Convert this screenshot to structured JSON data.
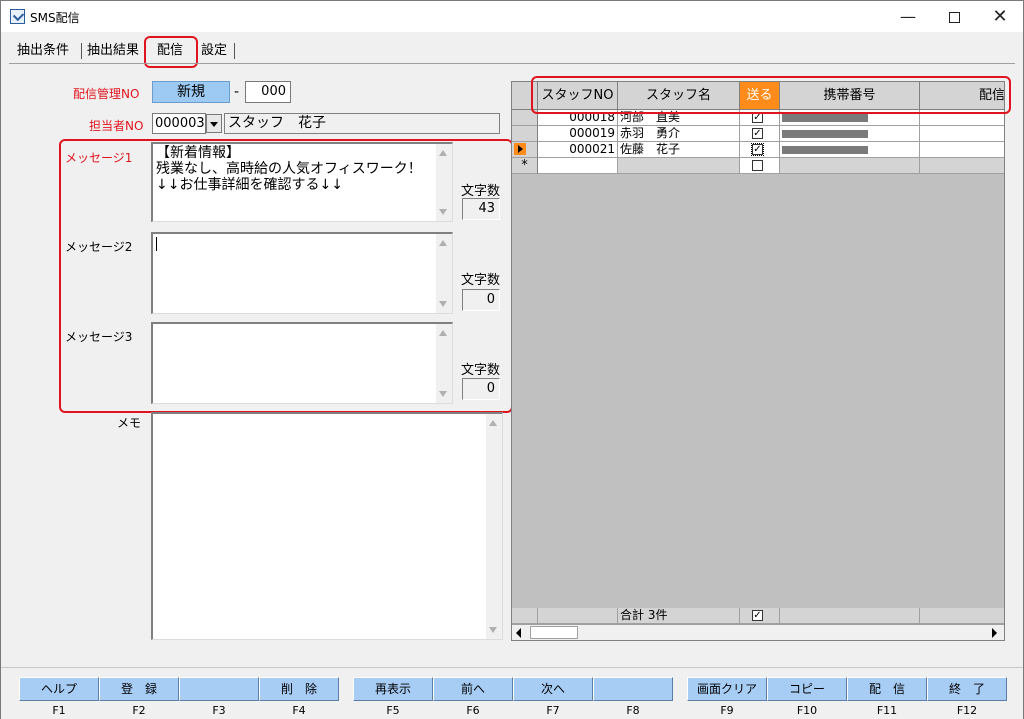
{
  "window": {
    "title": "SMS配信"
  },
  "tabs": [
    "抽出条件",
    "抽出結果",
    "配信",
    "設定"
  ],
  "form": {
    "mgmt_label": "配信管理NO",
    "mgmt_value": "新規",
    "mgmt_dash": "-",
    "mgmt_seq": "000",
    "staff_label": "担当者NO",
    "staff_no": "000003",
    "staff_name": "スタッフ　花子",
    "messages": [
      {
        "label": "メッセージ1",
        "text": "【新着情報】\n残業なし、高時給の人気オフィスワーク！\n↓↓お仕事詳細を確認する↓↓",
        "count_label": "文字数",
        "count": "43"
      },
      {
        "label": "メッセージ2",
        "text": "",
        "count_label": "文字数",
        "count": "0"
      },
      {
        "label": "メッセージ3",
        "text": "",
        "count_label": "文字数",
        "count": "0"
      }
    ],
    "memo_label": "メモ"
  },
  "grid": {
    "headers": [
      "スタッフNO",
      "スタッフ名",
      "送る",
      "携帯番号",
      "配信"
    ],
    "rows": [
      {
        "no": "000018",
        "name": "河部　直美",
        "send": true
      },
      {
        "no": "000019",
        "name": "赤羽　勇介",
        "send": true
      },
      {
        "no": "000021",
        "name": "佐藤　花子",
        "send": true
      }
    ],
    "new_row_marker": "*",
    "total": "合計 3件"
  },
  "fkeys": [
    {
      "label": "ヘルプ",
      "key": "F1"
    },
    {
      "label": "登　録",
      "key": "F2"
    },
    {
      "label": "",
      "key": "F3"
    },
    {
      "label": "削　除",
      "key": "F4"
    },
    {
      "label": "再表示",
      "key": "F5"
    },
    {
      "label": "前へ",
      "key": "F6"
    },
    {
      "label": "次へ",
      "key": "F7"
    },
    {
      "label": "",
      "key": "F8"
    },
    {
      "label": "画面クリア",
      "key": "F9"
    },
    {
      "label": "コピー",
      "key": "F10"
    },
    {
      "label": "配　信",
      "key": "F11"
    },
    {
      "label": "終　了",
      "key": "F12"
    }
  ],
  "colors": {
    "accent_red": "#e0141e",
    "button_blue": "#a8cdf5",
    "send_header": "#ff8c1a",
    "field_highlight": "#9ccaf2"
  }
}
